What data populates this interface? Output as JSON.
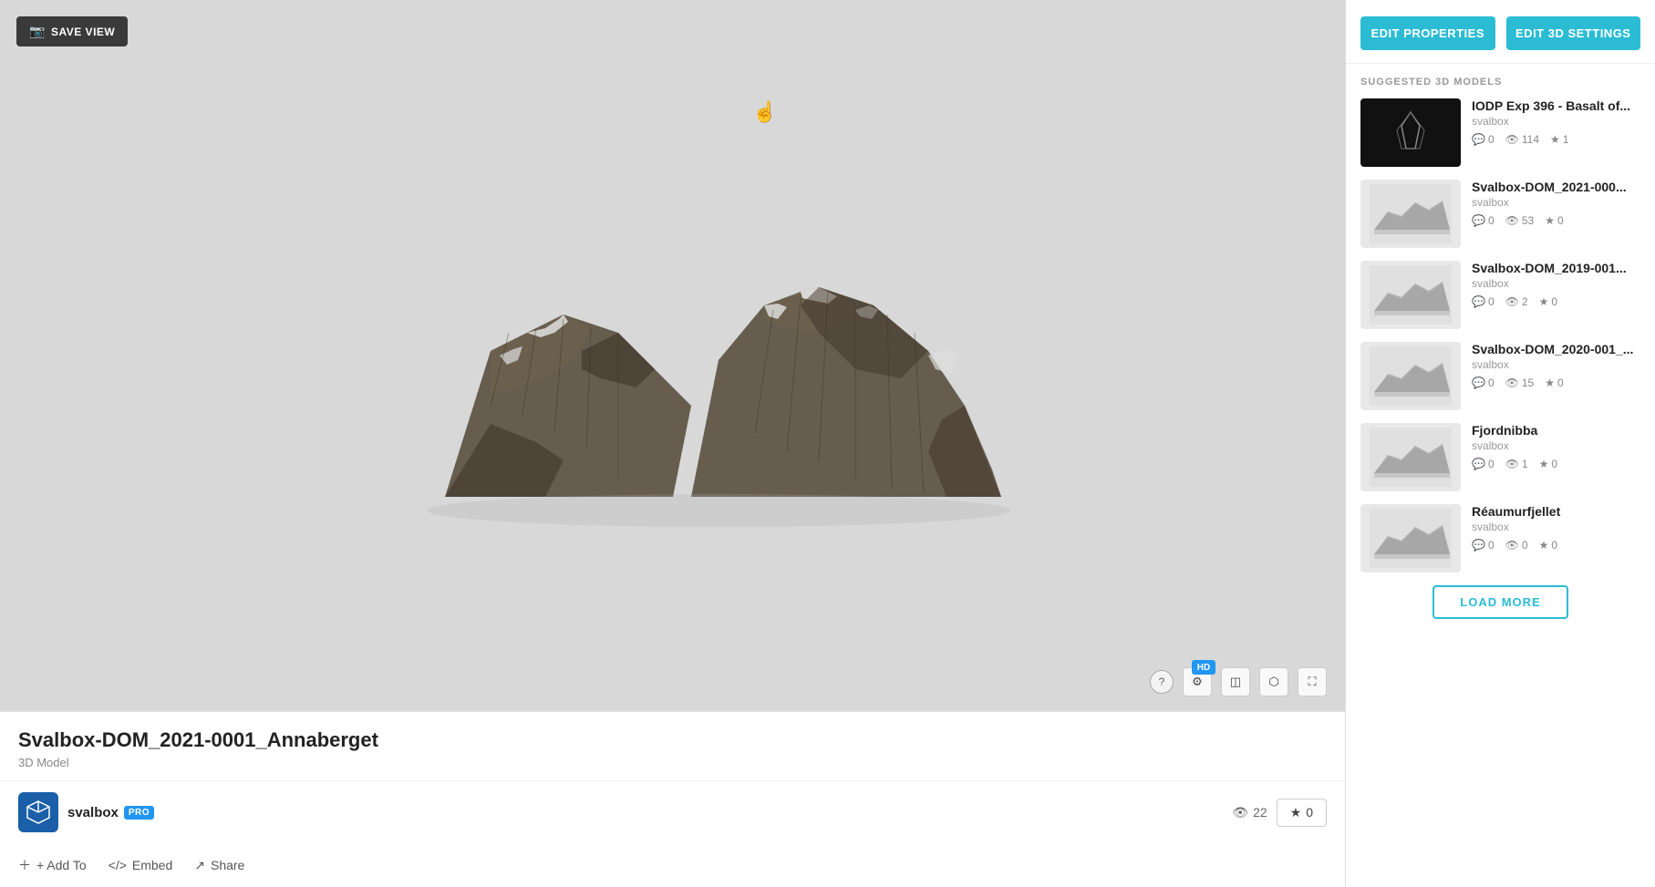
{
  "viewer": {
    "save_view_label": "SAVE VIEW",
    "model_title": "Svalbox-DOM_2021-0001_Annaberget",
    "model_type": "3D Model",
    "cursor_symbol": "☝"
  },
  "controls": {
    "help": "?",
    "hd": "HD",
    "settings": "⚙",
    "layers": "◫",
    "vr": "⬡",
    "fullscreen": "⛶"
  },
  "author": {
    "name": "svalbox",
    "pro_badge": "PRO",
    "views_count": "22",
    "likes_count": "0",
    "views_icon": "👁",
    "likes_icon": "★"
  },
  "actions": {
    "add_to_label": "+ Add To",
    "embed_label": "Embed",
    "share_label": "Share"
  },
  "sidebar": {
    "edit_properties_label": "EDIT PROPERTIES",
    "edit_3d_settings_label": "EDIT 3D SETTINGS",
    "suggested_title": "SUGGESTED 3D MODELS",
    "load_more_label": "LOAD MORE",
    "models": [
      {
        "title": "IODP Exp 396 - Basalt of...",
        "author": "svalbox",
        "comments": "0",
        "views": "114",
        "likes": "1",
        "thumb_type": "dark"
      },
      {
        "title": "Svalbox-DOM_2021-000...",
        "author": "svalbox",
        "comments": "0",
        "views": "53",
        "likes": "0",
        "thumb_type": "light"
      },
      {
        "title": "Svalbox-DOM_2019-001...",
        "author": "svalbox",
        "comments": "0",
        "views": "2",
        "likes": "0",
        "thumb_type": "light"
      },
      {
        "title": "Svalbox-DOM_2020-001_...",
        "author": "svalbox",
        "comments": "0",
        "views": "15",
        "likes": "0",
        "thumb_type": "light"
      },
      {
        "title": "Fjordnibba",
        "author": "svalbox",
        "comments": "0",
        "views": "1",
        "likes": "0",
        "thumb_type": "light"
      },
      {
        "title": "Réaumurfjellet",
        "author": "svalbox",
        "comments": "0",
        "views": "0",
        "likes": "0",
        "thumb_type": "light"
      }
    ]
  }
}
